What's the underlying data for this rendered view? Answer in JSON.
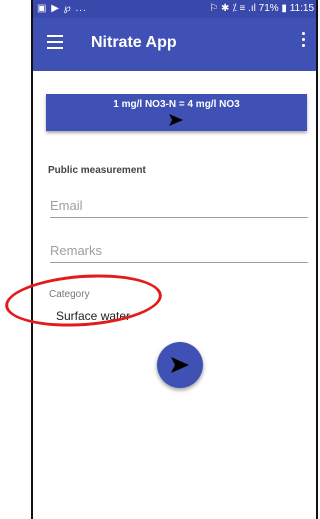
{
  "status_bar": {
    "left": "▣ ▶ ℘ ...",
    "right": "⚐ ✱ ⁒ ≡ .ıl 71% ▮ 11:15"
  },
  "app_bar": {
    "title": "Nitrate App"
  },
  "banner": {
    "text": "1 mg/l NO3-N = 4 mg/l NO3"
  },
  "form": {
    "section_title": "Public measurement",
    "email_placeholder": "Email",
    "remarks_placeholder": "Remarks",
    "category_label": "Category",
    "category_value": "Surface water"
  },
  "colors": {
    "primary": "#3f51b5",
    "status_bar": "#3949ab",
    "highlight": "#e31b1b"
  },
  "icons": [
    "menu-icon",
    "more-vert-icon",
    "arrow-right-icon",
    "send-icon"
  ]
}
